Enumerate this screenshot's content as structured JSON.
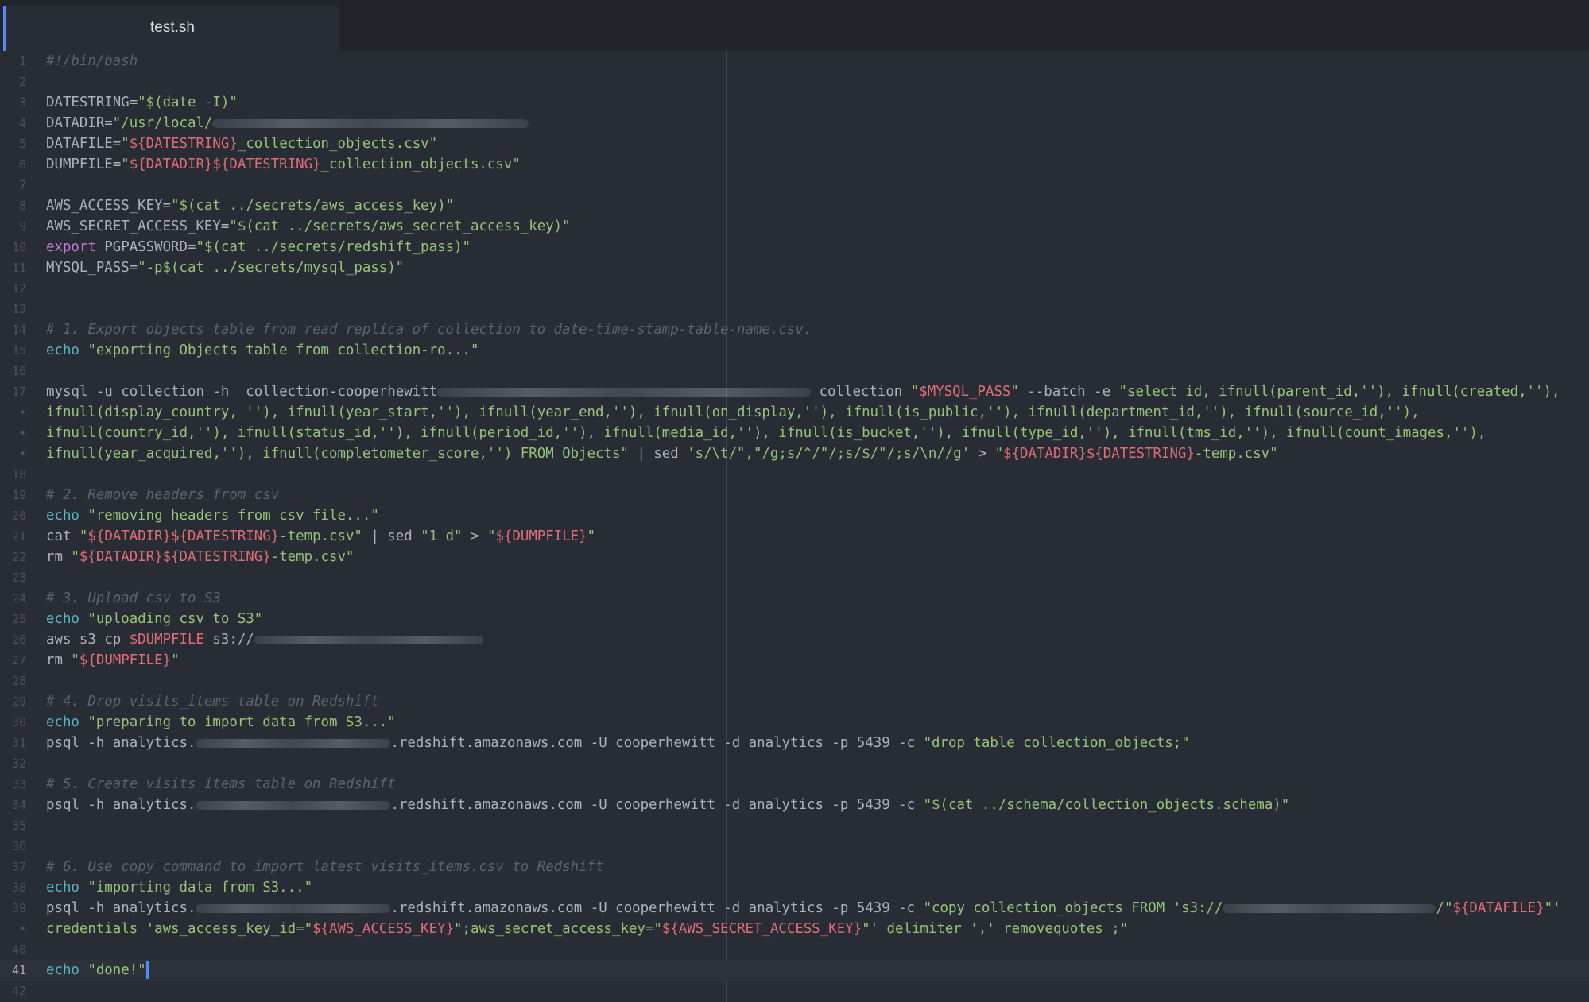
{
  "tab": {
    "title": "test.sh"
  },
  "editor": {
    "line_numbers": [
      "1",
      "2",
      "3",
      "4",
      "5",
      "6",
      "7",
      "8",
      "9",
      "10",
      "11",
      "12",
      "13",
      "14",
      "15",
      "16",
      "17",
      "•",
      "•",
      "•",
      "18",
      "19",
      "20",
      "21",
      "22",
      "23",
      "24",
      "25",
      "26",
      "27",
      "28",
      "29",
      "30",
      "31",
      "32",
      "33",
      "34",
      "35",
      "36",
      "37",
      "38",
      "39",
      "•",
      "40",
      "41",
      "42"
    ],
    "current_line": "41",
    "code": {
      "l1": "#!/bin/bash",
      "l3a": "DATESTRING=",
      "l3b": "\"$(date -I)\"",
      "l4a": "DATADIR=",
      "l4b": "\"/usr/local/",
      "l5a": "DATAFILE=",
      "l5b": "\"",
      "l5c": "${DATESTRING}",
      "l5d": "_collection_objects.csv\"",
      "l6a": "DUMPFILE=",
      "l6b": "\"",
      "l6c": "${DATADIR}${DATESTRING}",
      "l6d": "_collection_objects.csv\"",
      "l8a": "AWS_ACCESS_KEY=",
      "l8b": "\"$(cat ../secrets/aws_access_key)\"",
      "l9a": "AWS_SECRET_ACCESS_KEY=",
      "l9b": "\"$(cat ../secrets/aws_secret_access_key)\"",
      "l10a": "export",
      "l10b": " PGPASSWORD=",
      "l10c": "\"$(cat ../secrets/redshift_pass)\"",
      "l11a": "MYSQL_PASS=",
      "l11b": "\"-p$(cat ../secrets/mysql_pass)\"",
      "l14": "# 1. Export objects table from read replica of collection to date-time-stamp-table-name.csv.",
      "l15a": "echo",
      "l15b": " \"exporting Objects table from collection-ro...\"",
      "l17a": "mysql -u collection -h  collection-cooperhewitt",
      "l17b": " collection ",
      "l17c": "\"",
      "l17d": "$MYSQL_PASS",
      "l17e": "\"",
      "l17f": " --batch -e ",
      "l17g": "\"select id, ifnull(parent_id,''), ifnull(created,''),",
      "l17w1": "ifnull(display_country, ''), ifnull(year_start,''), ifnull(year_end,''), ifnull(on_display,''), ifnull(is_public,''), ifnull(department_id,''), ifnull(source_id,''),",
      "l17w2": "ifnull(country_id,''), ifnull(status_id,''), ifnull(period_id,''), ifnull(media_id,''), ifnull(is_bucket,''), ifnull(type_id,''), ifnull(tms_id,''), ifnull(count_images,''),",
      "l17w3a": "ifnull(year_acquired,''), ifnull(completometer_score,'') FROM Objects\"",
      "l17w3b": " | sed ",
      "l17w3c": "'s/\\t/\",\"/g;s/^/\"/;s/$/\"/;s/\\n//g'",
      "l17w3d": " > ",
      "l17w3e": "\"",
      "l17w3f": "${DATADIR}${DATESTRING}",
      "l17w3g": "-temp.csv\"",
      "l19": "# 2. Remove headers from csv",
      "l20a": "echo",
      "l20b": " \"removing headers from csv file...\"",
      "l21a": "cat ",
      "l21b": "\"",
      "l21c": "${DATADIR}${DATESTRING}",
      "l21d": "-temp.csv\"",
      "l21e": " | sed ",
      "l21f": "\"1 d\"",
      "l21g": " > ",
      "l21h": "\"",
      "l21i": "${DUMPFILE}",
      "l21j": "\"",
      "l22a": "rm ",
      "l22b": "\"",
      "l22c": "${DATADIR}${DATESTRING}",
      "l22d": "-temp.csv\"",
      "l24": "# 3. Upload csv to S3",
      "l25a": "echo",
      "l25b": " \"uploading csv to S3\"",
      "l26a": "aws s3 cp ",
      "l26b": "$DUMPFILE",
      "l26c": " s3://",
      "l27a": "rm ",
      "l27b": "\"",
      "l27c": "${DUMPFILE}",
      "l27d": "\"",
      "l29": "# 4. Drop visits_items table on Redshift",
      "l30a": "echo",
      "l30b": " \"preparing to import data from S3...\"",
      "l31a": "psql -h analytics.",
      "l31b": ".redshift.amazonaws.com -U cooperhewitt -d analytics -p 5439 -c ",
      "l31c": "\"drop table collection_objects;\"",
      "l33": "# 5. Create visits_items table on Redshift",
      "l34a": "psql -h analytics.",
      "l34b": ".redshift.amazonaws.com -U cooperhewitt -d analytics -p 5439 -c ",
      "l34c": "\"$(cat ../schema/collection_objects.schema)\"",
      "l37": "# 6. Use copy command to import latest visits_items.csv to Redshift",
      "l38a": "echo",
      "l38b": " \"importing data from S3...\"",
      "l39a": "psql -h analytics.",
      "l39b": ".redshift.amazonaws.com -U cooperhewitt -d analytics -p 5439 -c ",
      "l39c": "\"copy collection_objects FROM 's3://",
      "l39d": "/\"",
      "l39e": "${DATAFILE}",
      "l39f": "\"'",
      "l39w1a": "credentials 'aws_access_key_id=",
      "l39w1b": "\"",
      "l39w1c": "${AWS_ACCESS_KEY}",
      "l39w1d": "\"",
      "l39w1e": ";aws_secret_access_key=",
      "l39w1f": "\"",
      "l39w1g": "${AWS_SECRET_ACCESS_KEY}",
      "l39w1h": "\"",
      "l39w1i": "' delimiter ',' removequotes ;\"",
      "l41a": "echo",
      "l41b": " \"done!\""
    }
  }
}
